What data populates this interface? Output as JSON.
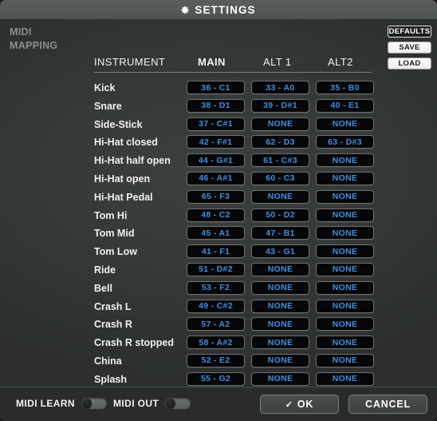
{
  "window": {
    "title": "SETTINGS",
    "gear_icon": "gear-icon"
  },
  "sidebar": {
    "line1": "MIDI",
    "line2": "MAPPING"
  },
  "table": {
    "headers": {
      "instrument": "INSTRUMENT",
      "main": "MAIN",
      "alt1": "ALT 1",
      "alt2": "ALT2"
    },
    "rows": [
      {
        "instrument": "Kick",
        "main": "36 - C1",
        "alt1": "33 - A0",
        "alt2": "35 - B0"
      },
      {
        "instrument": "Snare",
        "main": "38 - D1",
        "alt1": "39 - D#1",
        "alt2": "40 - E1"
      },
      {
        "instrument": "Side-Stick",
        "main": "37 - C#1",
        "alt1": "NONE",
        "alt2": "NONE"
      },
      {
        "instrument": "Hi-Hat closed",
        "main": "42 - F#1",
        "alt1": "62 - D3",
        "alt2": "63 - D#3"
      },
      {
        "instrument": "Hi-Hat half open",
        "main": "44 - G#1",
        "alt1": "61 - C#3",
        "alt2": "NONE"
      },
      {
        "instrument": "Hi-Hat open",
        "main": "46 - A#1",
        "alt1": "60 - C3",
        "alt2": "NONE"
      },
      {
        "instrument": "Hi-Hat Pedal",
        "main": "65 - F3",
        "alt1": "NONE",
        "alt2": "NONE"
      },
      {
        "instrument": "Tom Hi",
        "main": "48 - C2",
        "alt1": "50 - D2",
        "alt2": "NONE"
      },
      {
        "instrument": "Tom Mid",
        "main": "45 - A1",
        "alt1": "47 - B1",
        "alt2": "NONE"
      },
      {
        "instrument": "Tom Low",
        "main": "41 - F1",
        "alt1": "43 - G1",
        "alt2": "NONE"
      },
      {
        "instrument": "Ride",
        "main": "51 - D#2",
        "alt1": "NONE",
        "alt2": "NONE"
      },
      {
        "instrument": "Bell",
        "main": "53 - F2",
        "alt1": "NONE",
        "alt2": "NONE"
      },
      {
        "instrument": "Crash L",
        "main": "49 - C#2",
        "alt1": "NONE",
        "alt2": "NONE"
      },
      {
        "instrument": "Crash R",
        "main": "57 - A2",
        "alt1": "NONE",
        "alt2": "NONE"
      },
      {
        "instrument": "Crash R stopped",
        "main": "58 - A#2",
        "alt1": "NONE",
        "alt2": "NONE"
      },
      {
        "instrument": "China",
        "main": "52 - E2",
        "alt1": "NONE",
        "alt2": "NONE"
      },
      {
        "instrument": "Splash",
        "main": "55 - G2",
        "alt1": "NONE",
        "alt2": "NONE"
      }
    ]
  },
  "side_buttons": {
    "defaults": "DEFAULTS",
    "save": "SAVE",
    "load": "LOAD"
  },
  "footer": {
    "midi_learn_label": "MIDI LEARN",
    "midi_learn_state": "off",
    "midi_out_label": "MIDI OUT",
    "midi_out_state": "off",
    "ok_label": "OK",
    "ok_check": "✓",
    "cancel_label": "CANCEL"
  },
  "colors": {
    "value_text": "#3f8fe0",
    "panel_bg": "#363939",
    "titlebar": "#55595a",
    "cell_bg": "#060608"
  }
}
